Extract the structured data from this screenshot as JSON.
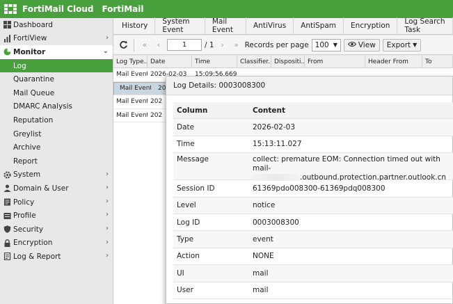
{
  "app": {
    "brand": "FortiMail Cloud",
    "product": "FortiMail"
  },
  "sidebar": {
    "items": [
      {
        "label": "Dashboard",
        "icon": "dashboard-icon",
        "chevron": ""
      },
      {
        "label": "FortiView",
        "icon": "chart-icon",
        "chevron": ">"
      },
      {
        "label": "Monitor",
        "icon": "monitor-icon",
        "chevron": "v"
      },
      {
        "label": "Log"
      },
      {
        "label": "Quarantine"
      },
      {
        "label": "Mail Queue"
      },
      {
        "label": "DMARC Analysis"
      },
      {
        "label": "Reputation"
      },
      {
        "label": "Greylist"
      },
      {
        "label": "Archive"
      },
      {
        "label": "Report"
      },
      {
        "label": "System",
        "icon": "gear-icon",
        "chevron": ">"
      },
      {
        "label": "Domain & User",
        "icon": "user-icon",
        "chevron": ">"
      },
      {
        "label": "Policy",
        "icon": "policy-icon",
        "chevron": ">"
      },
      {
        "label": "Profile",
        "icon": "profile-icon",
        "chevron": ">"
      },
      {
        "label": "Security",
        "icon": "shield-icon",
        "chevron": ">"
      },
      {
        "label": "Encryption",
        "icon": "lock-icon",
        "chevron": ">"
      },
      {
        "label": "Log & Report",
        "icon": "report-icon",
        "chevron": ">"
      }
    ]
  },
  "tabs": [
    "History",
    "System Event",
    "Mail Event",
    "AntiVirus",
    "AntiSpam",
    "Encryption",
    "Log Search Task"
  ],
  "toolbar": {
    "page_value": "1",
    "page_total": "/ 1",
    "records_label": "Records per page",
    "records_value": "100",
    "view_label": "View",
    "export_label": "Export"
  },
  "grid": {
    "columns": [
      "Log Type...",
      "Date",
      "Time",
      "Classifier...",
      "Dispositi...",
      "From",
      "Header From",
      "To"
    ],
    "rows": [
      {
        "type": "Mail Event",
        "date": "2026-02-03",
        "time": "15:09:56.669"
      },
      {
        "type": "Mail Event",
        "date": "2026-",
        "time": ""
      },
      {
        "type": "Mail Event",
        "date": "202",
        "time": ""
      },
      {
        "type": "Mail Event",
        "date": "202",
        "time": ""
      }
    ]
  },
  "modal": {
    "title": "Log Details: 0003008300",
    "header": {
      "col1": "Column",
      "col2": "Content"
    },
    "rows": [
      {
        "k": "Date",
        "v": "2026-02-03"
      },
      {
        "k": "Time",
        "v": "15:13:11.027"
      },
      {
        "k": "Message",
        "v": "collect: premature EOM: Connection timed out with mail-",
        "v2": ".outbound.protection.partner.outlook.cn"
      },
      {
        "k": "Session ID",
        "v": "61369pdo008300-61369pdq008300"
      },
      {
        "k": "Level",
        "v": "notice"
      },
      {
        "k": "Log ID",
        "v": "0003008300"
      },
      {
        "k": "Type",
        "v": "event"
      },
      {
        "k": "Action",
        "v": "NONE"
      },
      {
        "k": "UI",
        "v": "mail"
      },
      {
        "k": "User",
        "v": "mail"
      }
    ]
  },
  "colors": {
    "brand_green": "#49a13d",
    "selection": "#c8d6e2"
  }
}
